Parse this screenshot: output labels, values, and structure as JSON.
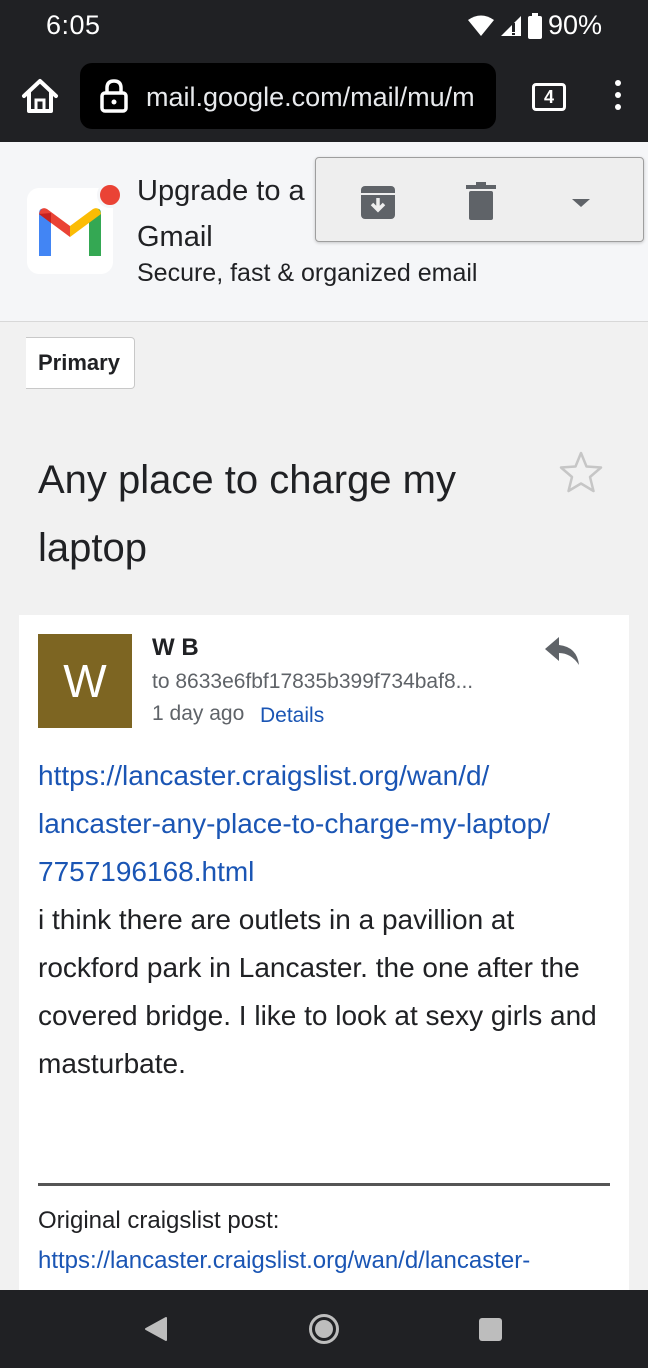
{
  "status_bar": {
    "time": "6:05",
    "battery": "90%",
    "icons": [
      "wifi-icon",
      "signal-icon",
      "battery-icon"
    ]
  },
  "browser": {
    "url": "mail.google.com/mail/mu/m",
    "tab_count": "4",
    "icons": [
      "home-icon",
      "lock-icon",
      "tabs-icon",
      "menu-icon"
    ]
  },
  "banner": {
    "title": "Upgrade to a new Gmail",
    "title_line1": "Upgrade to a",
    "title_line2": "Gmail",
    "subtitle": "Secure, fast & organized email"
  },
  "actions": {
    "icons": [
      "archive-icon",
      "delete-icon",
      "dropdown-icon"
    ]
  },
  "label": {
    "name": "Primary"
  },
  "email": {
    "subject": "Any place to charge my laptop",
    "sender_initial": "W",
    "sender_name": "W B",
    "recipient": "to 8633e6fbf17835b399f734baf8...",
    "date": "1 day ago",
    "details_link": "Details",
    "body_link_lines": [
      "https://lancaster.craigslist.org/wan/d/",
      "lancaster-any-place-to-charge-my-laptop/",
      "7757196168.html"
    ],
    "body_text": "i think there are outlets in a pavillion at rockford park in Lancaster. the one after the covered bridge. I like to look at sexy girls and masturbate.",
    "original_label": "Original craigslist post:",
    "original_link": "https://lancaster.craigslist.org/wan/d/lancaster-"
  },
  "colors": {
    "avatar": "#7d6522",
    "link": "#1a55b4",
    "notification_dot": "#ea4335",
    "system_bar": "#202124"
  }
}
